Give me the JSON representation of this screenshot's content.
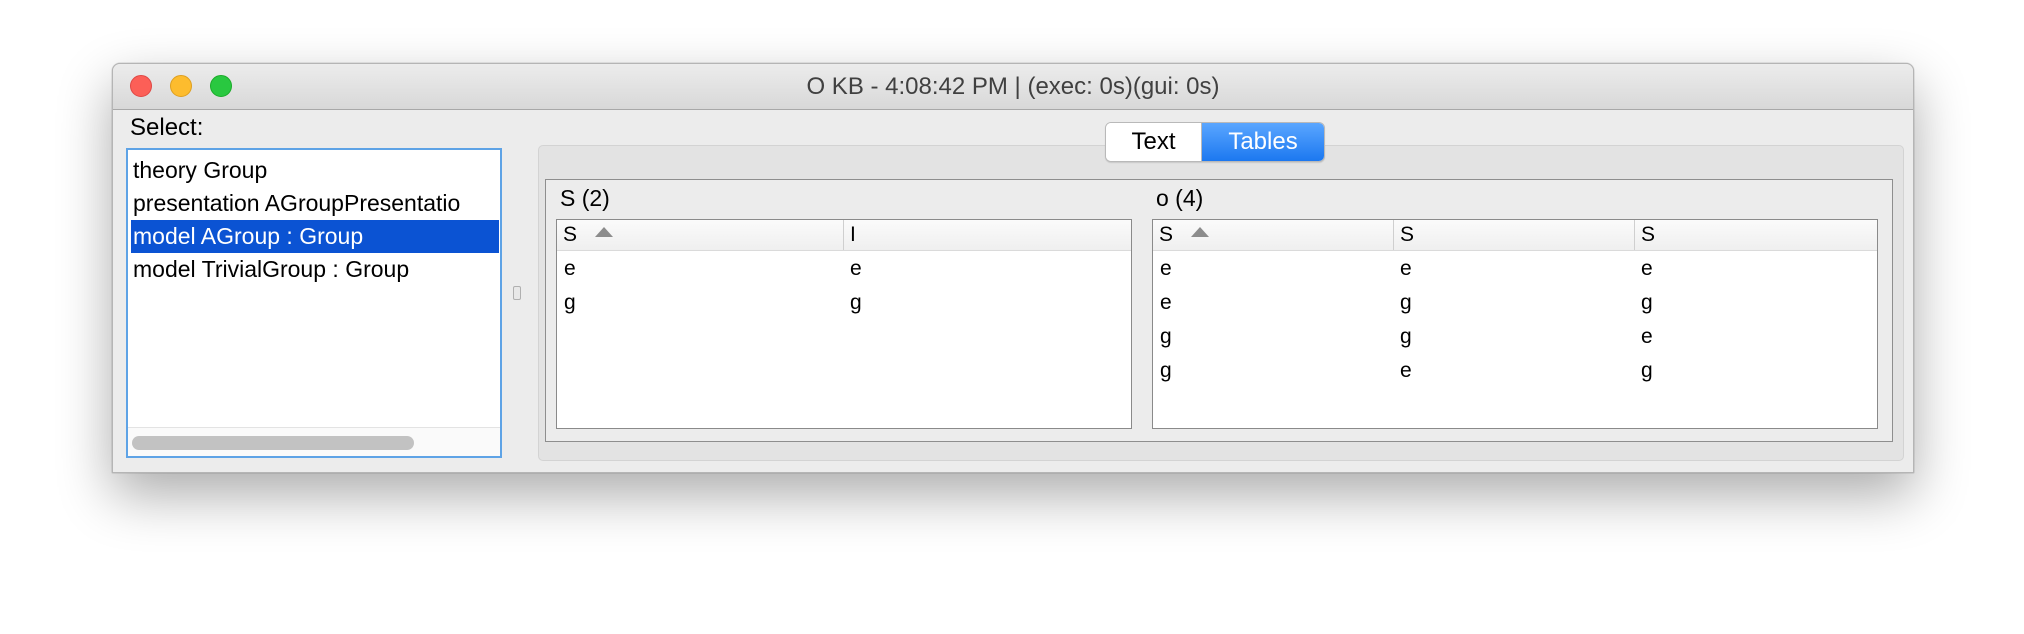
{
  "window": {
    "title": "O KB - 4:08:42 PM | (exec: 0s)(gui: 0s)"
  },
  "select_label": "Select:",
  "list": {
    "items": [
      {
        "label": "theory Group",
        "selected": false
      },
      {
        "label": "presentation AGroupPresentatio",
        "selected": false
      },
      {
        "label": "model AGroup : Group",
        "selected": true
      },
      {
        "label": "model TrivialGroup : Group",
        "selected": false
      }
    ]
  },
  "tabs": [
    {
      "label": "Text",
      "active": false
    },
    {
      "label": "Tables",
      "active": true
    }
  ],
  "tables": [
    {
      "title": "S (2)",
      "columns": [
        {
          "label": "S",
          "sorted": "ascending"
        },
        {
          "label": "I"
        }
      ],
      "rows": [
        [
          "e",
          "e"
        ],
        [
          "g",
          "g"
        ]
      ]
    },
    {
      "title": "o (4)",
      "columns": [
        {
          "label": "S",
          "sorted": "ascending"
        },
        {
          "label": "S"
        },
        {
          "label": "S"
        }
      ],
      "rows": [
        [
          "e",
          "e",
          "e"
        ],
        [
          "e",
          "g",
          "g"
        ],
        [
          "g",
          "g",
          "e"
        ],
        [
          "g",
          "e",
          "g"
        ]
      ]
    }
  ],
  "colors": {
    "selection": "#0b53d3",
    "active_tab": "#1c78f0",
    "close": "#fc5f57",
    "minimize": "#fdbc2e",
    "maximize": "#29c840"
  }
}
